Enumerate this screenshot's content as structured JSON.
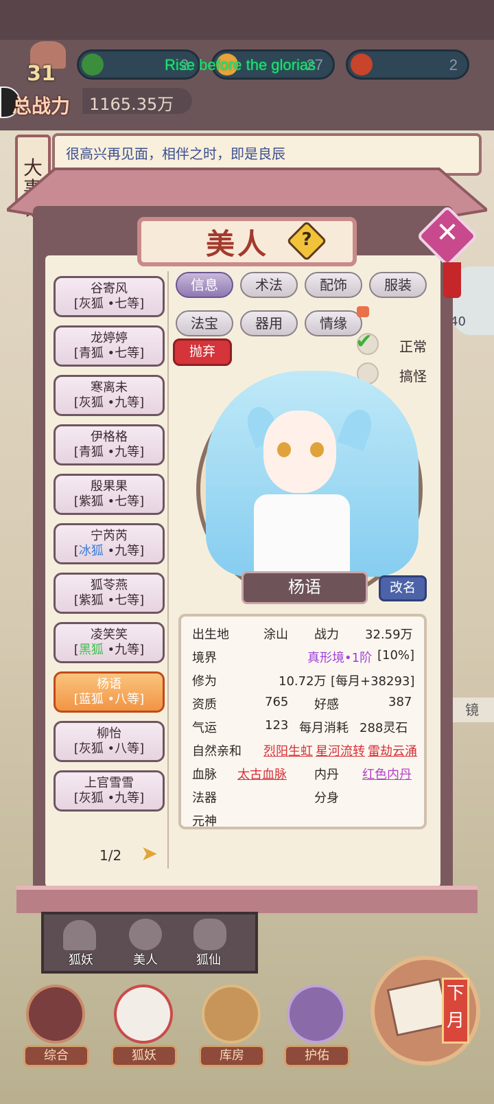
{
  "header": {
    "level": "31",
    "power_label": "总战力",
    "power_value": "1165.35万",
    "resources": [
      {
        "icon": "leaf-gem-icon",
        "value": "2"
      },
      {
        "icon": "gold-fruit-icon",
        "value": "27"
      },
      {
        "icon": "red-fruit-icon",
        "value": "2"
      }
    ],
    "marquee": "Rise before the glorias"
  },
  "greeting": "很高兴再见面，相伴之时，即是良辰",
  "side_tag": "大事记",
  "right_edge": {
    "badge_value": "40",
    "mirror_label": "镜"
  },
  "dialog": {
    "title": "美人",
    "help_icon": "question-icon",
    "close_icon": "close-icon",
    "list": [
      {
        "name": "谷寄风",
        "tag": "[灰狐 •七等]"
      },
      {
        "name": "龙婷婷",
        "tag": "[青狐 •七等]"
      },
      {
        "name": "寒离未",
        "tag": "[灰狐 •九等]"
      },
      {
        "name": "伊格格",
        "tag": "[青狐 •九等]"
      },
      {
        "name": "殷果果",
        "tag": "[紫狐 •七等]"
      },
      {
        "name": "宁芮芮",
        "tag_pre": "[",
        "tag_color": "冰狐",
        "tag_post": " •九等]"
      },
      {
        "name": "狐苓燕",
        "tag": "[紫狐 •七等]"
      },
      {
        "name": "凌笑笑",
        "tag_pre": "[",
        "tag_color": "黑狐",
        "tag_post": " •九等]"
      },
      {
        "name": "杨语",
        "tag": "[蓝狐 •八等]",
        "selected": true
      },
      {
        "name": "柳怡",
        "tag": "[灰狐 •八等]"
      },
      {
        "name": "上官雪雪",
        "tag": "[灰狐 •九等]"
      }
    ],
    "pager": "1/2",
    "tabs": [
      "信息",
      "术法",
      "配饰",
      "服装",
      "法宝",
      "器用",
      "情缘"
    ],
    "selected_tab": "信息",
    "abandon_label": "抛弃",
    "mode_normal": "正常",
    "mode_weird": "搞怪",
    "character_name": "杨语",
    "rename_label": "改名",
    "stats": {
      "birthplace_label": "出生地",
      "birthplace": "涂山",
      "combat_label": "战力",
      "combat": "32.59万",
      "realm_label": "境界",
      "realm": "真形境•1阶",
      "realm_pct": "[10%]",
      "cultivation_label": "修为",
      "cultivation": "10.72万",
      "cultivation_rate": "[每月+38293]",
      "aptitude_label": "资质",
      "aptitude": "765",
      "favor_label": "好感",
      "favor": "387",
      "luck_label": "气运",
      "luck": "123",
      "monthly_cost_label": "每月消耗",
      "monthly_cost": "288灵石",
      "affinity_label": "自然亲和",
      "affinity_1": "烈阳生虹",
      "affinity_2": "星河流转",
      "affinity_3": "雷劫云涌",
      "bloodline_label": "血脉",
      "bloodline": "太古血脉",
      "core_label": "内丹",
      "core": "红色内丹",
      "artifact_label": "法器",
      "clone_label": "分身",
      "spirit_label": "元神"
    }
  },
  "subnav": [
    {
      "label": "狐妖",
      "icon": "fox-icon"
    },
    {
      "label": "美人",
      "icon": "beauty-icon"
    },
    {
      "label": "狐仙",
      "icon": "fox-immortal-icon"
    }
  ],
  "bottom_nav": [
    {
      "label": "综合",
      "icon": "gate-icon"
    },
    {
      "label": "狐妖",
      "icon": "fox-mask-icon"
    },
    {
      "label": "库房",
      "icon": "storehouse-icon"
    },
    {
      "label": "护佑",
      "icon": "lotus-icon"
    }
  ],
  "next_month_label": "下月"
}
